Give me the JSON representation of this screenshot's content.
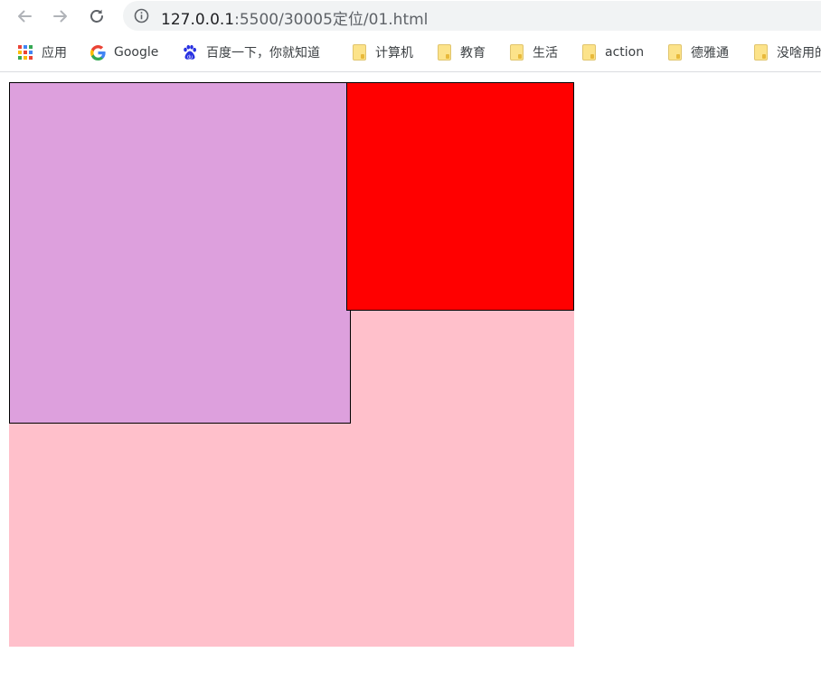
{
  "browser": {
    "url_host": "127.0.0.1",
    "url_path": ":5500/30005定位/01.html",
    "nav": {
      "back_icon": "arrow-left-icon",
      "forward_icon": "arrow-right-icon",
      "reload_icon": "reload-icon",
      "info_icon": "info-icon"
    }
  },
  "bookmarks": [
    {
      "label": "应用",
      "icon": "apps-grid-icon"
    },
    {
      "label": "Google",
      "icon": "google-g-icon"
    },
    {
      "label": "百度一下，你就知道",
      "icon": "baidu-paw-icon"
    },
    {
      "label": "计算机",
      "icon": "folder-icon"
    },
    {
      "label": "教育",
      "icon": "folder-icon"
    },
    {
      "label": "生活",
      "icon": "folder-icon"
    },
    {
      "label": "action",
      "icon": "folder-icon"
    },
    {
      "label": "德雅通",
      "icon": "folder-icon"
    },
    {
      "label": "没啥用的",
      "icon": "folder-icon"
    }
  ],
  "page": {
    "boxes": [
      {
        "name": "outer-box",
        "color": "#ffc0cb"
      },
      {
        "name": "plum-box",
        "color": "#dda0dd"
      },
      {
        "name": "red-box",
        "color": "#ff0000"
      }
    ]
  }
}
